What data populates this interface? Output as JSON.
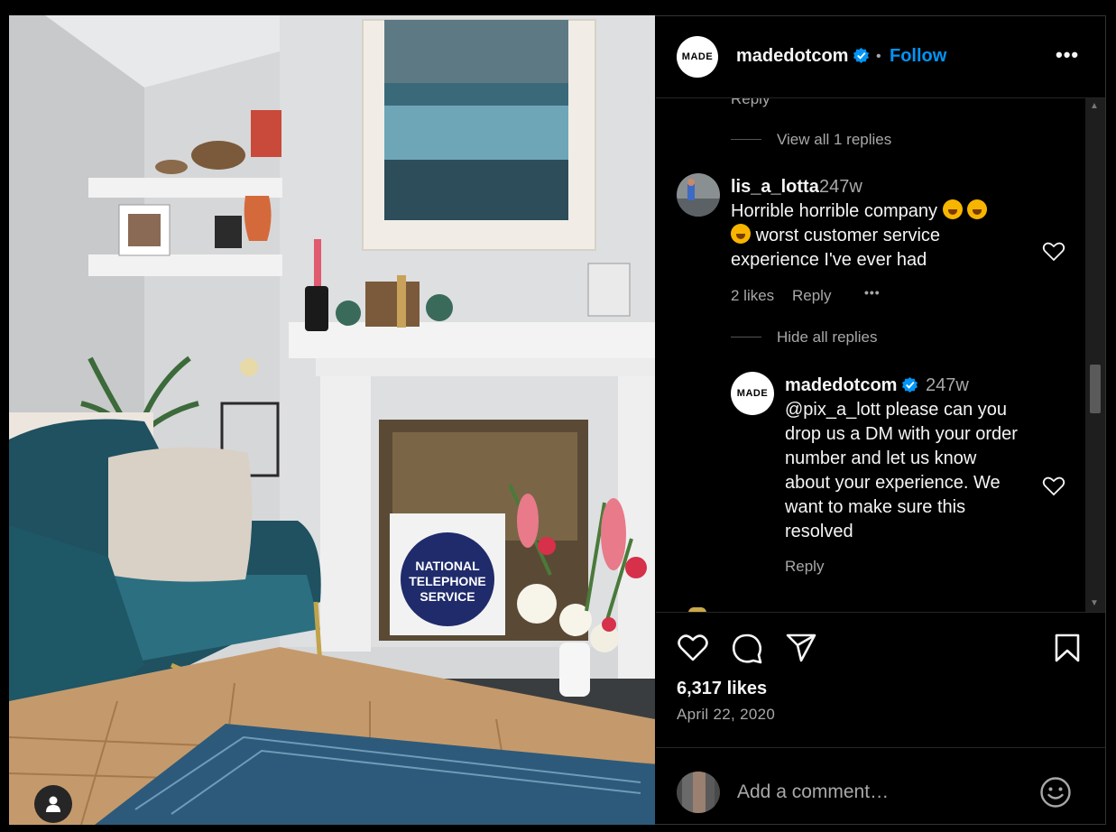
{
  "post": {
    "author": "madedotcom",
    "avatar_text": "MADE",
    "follow_label": "Follow",
    "separator": "•",
    "more_label": "•••"
  },
  "comments": {
    "partial_reply_label": "Reply",
    "thread1_view_replies": "View all 1 replies",
    "comment": {
      "username": "lis_a_lotta",
      "age": "247w",
      "line1": "Horrible horrible company",
      "line2": "worst customer service",
      "line3": "experience I've ever had",
      "likes": "2 likes",
      "reply_label": "Reply",
      "more_label": "•••"
    },
    "hide_replies": "Hide all replies",
    "reply": {
      "username": "madedotcom",
      "age": "247w",
      "avatar_text": "MADE",
      "lines": [
        "@pix_a_lott please can you",
        "drop us a DM with your order",
        "number and let us know",
        "about your experience. We",
        "want to make sure this",
        "resolved"
      ],
      "reply_label": "Reply"
    }
  },
  "stats": {
    "likes": "6,317 likes",
    "date": "April 22, 2020"
  },
  "composer": {
    "placeholder": "Add a comment…"
  },
  "colors": {
    "accent": "#0095f6",
    "verified": "#0095f6",
    "background": "#000000",
    "secondary_text": "#a8a8a8"
  },
  "icons": [
    "verified-badge-icon",
    "heart-icon",
    "comment-icon",
    "share-icon",
    "bookmark-icon",
    "emoji-icon",
    "user-tag-icon",
    "more-icon"
  ]
}
